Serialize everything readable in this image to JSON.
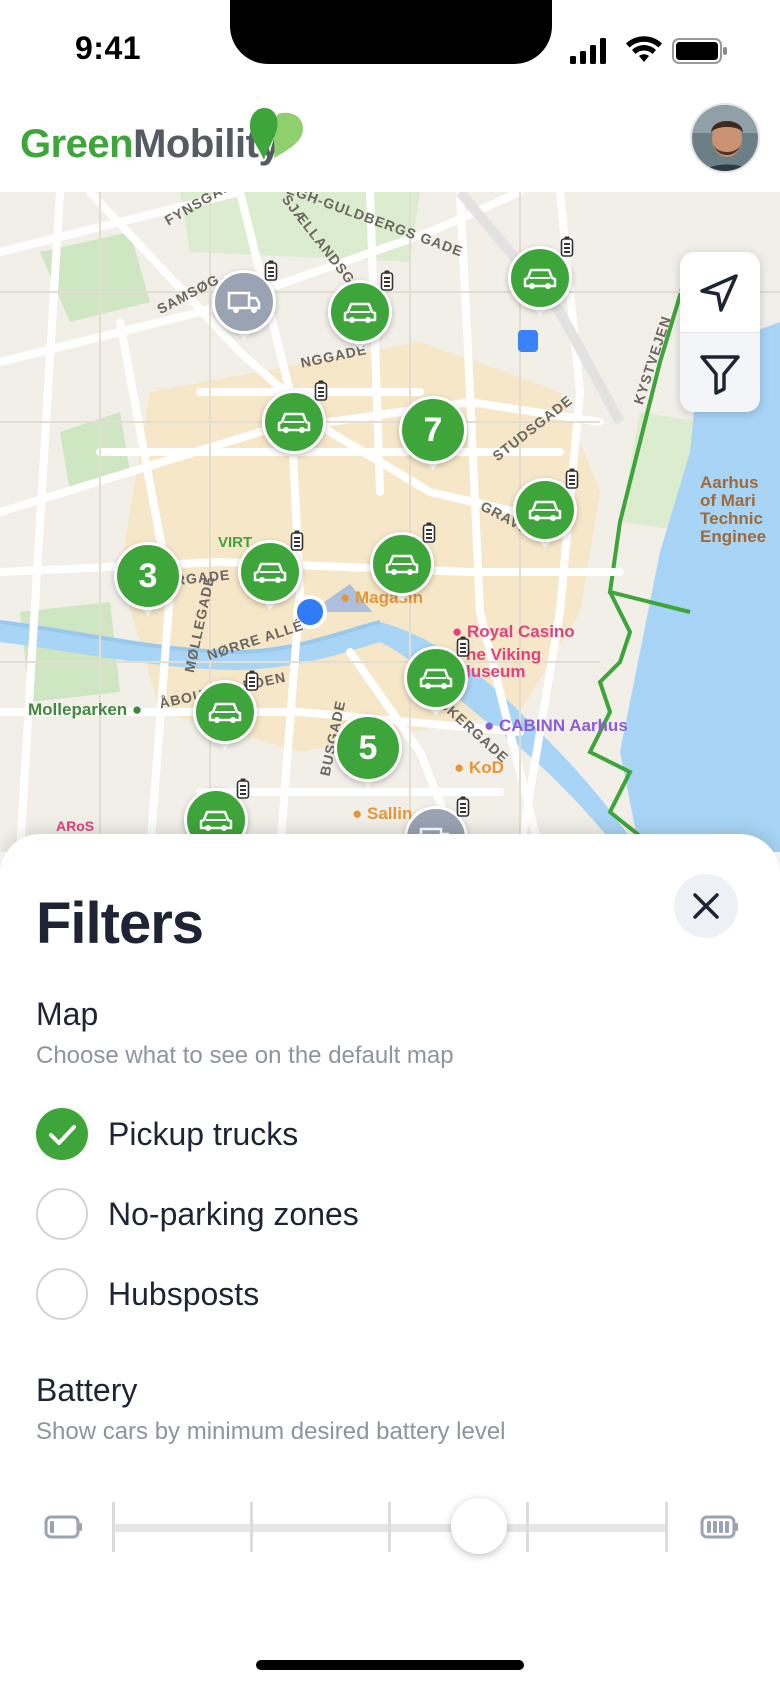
{
  "status_bar": {
    "time": "9:41"
  },
  "header": {
    "logo_green": "Green",
    "logo_grey": "Mobility"
  },
  "map": {
    "streets": [
      "FYNSGADE",
      "NØRRE ALLÉ",
      "VESTERGADE",
      "SJÆLLANDSGADE",
      "ØEGH-GULDBERGS GADE",
      "SAMSØG",
      "NGGADE",
      "STUDSGADE",
      "GRAVEN",
      "MØLLEGADE",
      "ÅBOULEVARDEN",
      "BUSGADE",
      "FISKERGADE",
      "KYSTVEJEN"
    ],
    "pois": {
      "royal_casino": "Royal Casino",
      "viking_museum": "he Viking\nluseum",
      "magasin": "Magasin",
      "cabinn": "CABINN Aarhus",
      "kod": "KoD",
      "salling": "Sallin",
      "aros": "ARoS",
      "molleparken": "Molleparken",
      "virt": "VIRT",
      "aarhus_school": "Aarhus\nof Mari\nTechnic\nEnginee"
    },
    "clusters": [
      "7",
      "3",
      "5"
    ],
    "colors": {
      "brand_green": "#3ea53a",
      "pin_grey": "#9aa3b2",
      "water": "#a8d4f5",
      "park": "#cfe6c2"
    }
  },
  "filters": {
    "title": "Filters",
    "map_section": {
      "title": "Map",
      "subtitle": "Choose what to see on the default map",
      "options": [
        {
          "label": "Pickup trucks",
          "checked": true
        },
        {
          "label": "No-parking zones",
          "checked": false
        },
        {
          "label": "Hubsposts",
          "checked": false
        }
      ]
    },
    "battery_section": {
      "title": "Battery",
      "subtitle": "Show cars by minimum desired battery level",
      "slider_value_fraction": 0.75
    }
  }
}
